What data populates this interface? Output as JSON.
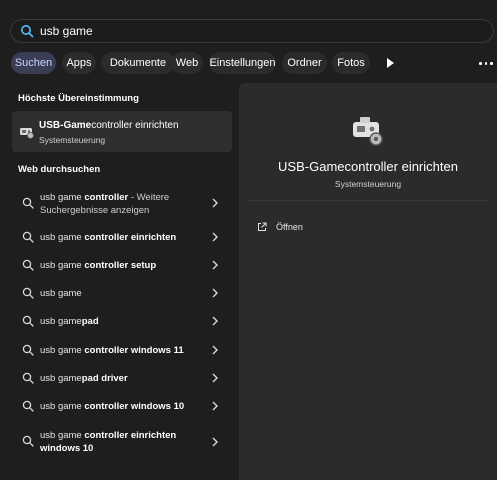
{
  "search": {
    "value": "usb game"
  },
  "tabs": [
    {
      "label": "Suchen",
      "active": true
    },
    {
      "label": "Apps"
    },
    {
      "label": "Dokumente"
    },
    {
      "label": "Web"
    },
    {
      "label": "Einstellungen"
    },
    {
      "label": "Ordner"
    },
    {
      "label": "Fotos"
    }
  ],
  "best_match": {
    "heading": "Höchste Übereinstimmung",
    "title_bold": "USB-Game",
    "title_rest": "controller einrichten",
    "subtitle": "Systemsteuerung"
  },
  "web": {
    "heading": "Web durchsuchen",
    "items": [
      {
        "normal": "usb game ",
        "bold": "controller",
        "extra": " - Weitere Suchergebnisse anzeigen"
      },
      {
        "normal": "usb game ",
        "bold": "controller einrichten",
        "extra": ""
      },
      {
        "normal": "usb game ",
        "bold": "controller setup",
        "extra": ""
      },
      {
        "normal": "usb game",
        "bold": "",
        "extra": ""
      },
      {
        "normal": "usb game",
        "bold": "pad",
        "extra": ""
      },
      {
        "normal": "usb game ",
        "bold": "controller windows 11",
        "extra": ""
      },
      {
        "normal": "usb game",
        "bold": "pad driver",
        "extra": ""
      },
      {
        "normal": "usb game ",
        "bold": "controller windows 10",
        "extra": ""
      },
      {
        "normal": "usb game ",
        "bold": "controller einrichten windows 10",
        "extra": ""
      }
    ]
  },
  "preview": {
    "title": "USB-Gamecontroller einrichten",
    "subtitle": "Systemsteuerung",
    "actions": [
      {
        "label": "Öffnen",
        "icon": "open-external-icon"
      }
    ]
  },
  "colors": {
    "accent_active_tab": "#3b3d54",
    "search_icon": "#4cc2ff"
  }
}
